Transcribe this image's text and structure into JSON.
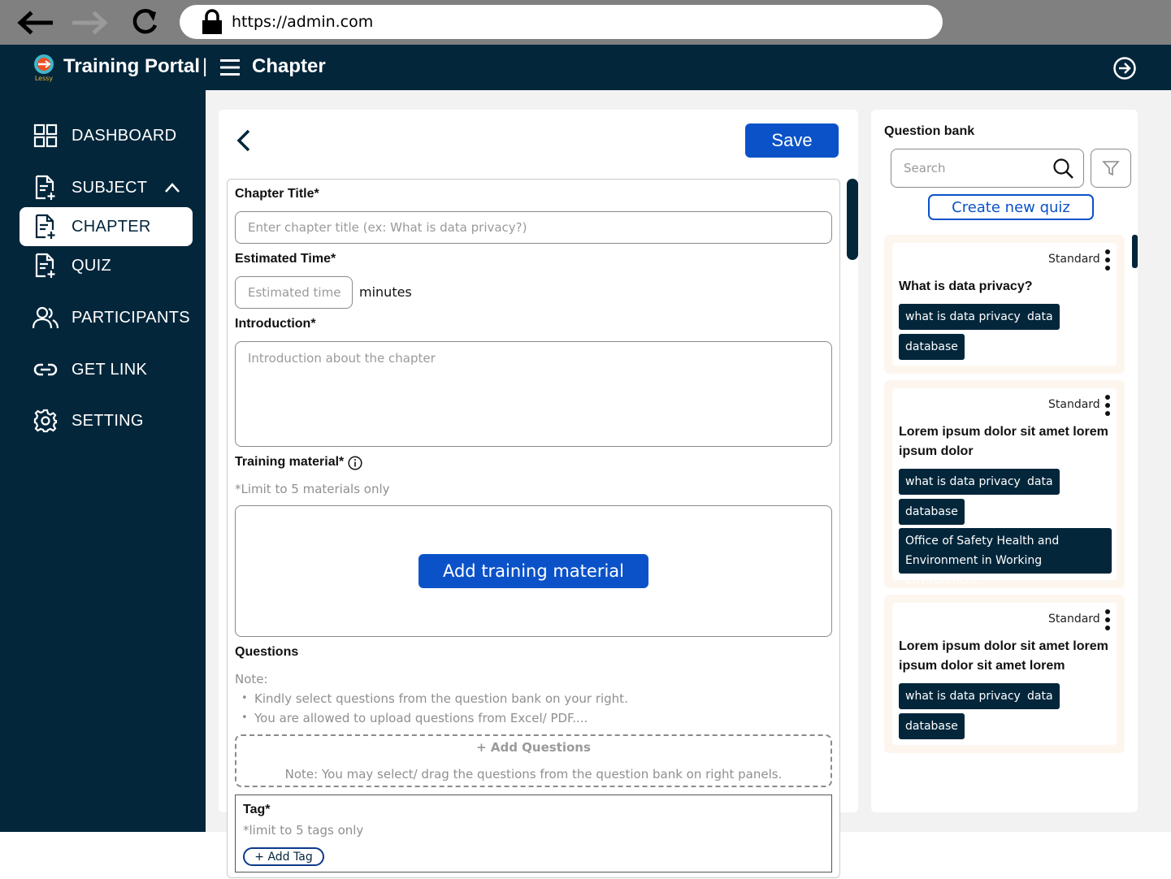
{
  "browser": {
    "url": "https://admin.com"
  },
  "header": {
    "app_title": "Training Portal",
    "separator": "|",
    "page_title": "Chapter",
    "logo_text": "Lessy"
  },
  "sidebar": {
    "items": [
      {
        "label": "DASHBOARD",
        "icon": "grid-icon"
      },
      {
        "label": "SUBJECT",
        "icon": "document-add-icon"
      },
      {
        "label": "CHAPTER",
        "icon": "document-add-icon",
        "active": true
      },
      {
        "label": "QUIZ",
        "icon": "document-add-icon"
      },
      {
        "label": "PARTICIPANTS",
        "icon": "users-icon"
      },
      {
        "label": "GET LINK",
        "icon": "link-icon"
      },
      {
        "label": "SETTING",
        "icon": "gear-icon"
      }
    ]
  },
  "toolbar": {
    "save_label": "Save"
  },
  "form": {
    "chapter_title_label": "Chapter Title*",
    "chapter_title_placeholder": "Enter chapter title (ex: What is data privacy?)",
    "estimated_time_label": "Estimated Time*",
    "estimated_time_placeholder": "Estimated time",
    "estimated_time_unit": "minutes",
    "introduction_label": "Introduction*",
    "introduction_placeholder": "Introduction about the chapter",
    "training_material_label": "Training material*",
    "training_material_hint": "*Limit to 5 materials only",
    "add_material_label": "Add training material",
    "questions_label": "Questions",
    "note_label": "Note:",
    "notes": [
      "Kindly select questions from the question bank on your right.",
      "You are allowed to upload questions from Excel/ PDF...."
    ],
    "add_questions_label": "+ Add Questions",
    "drag_note": "Note: You may select/ drag the questions from the question bank on right panels.",
    "tag_label": "Tag*",
    "tag_hint": "*limit to 5 tags only",
    "add_tag_label": "+ Add Tag"
  },
  "question_bank": {
    "title": "Question bank",
    "search_placeholder": "Search",
    "create_quiz_label": "Create new quiz",
    "questions": [
      {
        "type": "Standard",
        "title": "What is data privacy?",
        "tags": [
          "what is data privacy",
          "data",
          "database"
        ]
      },
      {
        "type": "Standard",
        "title": "Lorem ipsum dolor sit amet lorem ipsum dolor",
        "tags": [
          "what is data privacy",
          "data",
          "database",
          "Office of Safety Health and Environment in Working Environment"
        ]
      },
      {
        "type": "Standard",
        "title": "Lorem ipsum dolor sit amet lorem ipsum dolor sit amet lorem",
        "tags": [
          "what is data privacy",
          "data",
          "database"
        ]
      }
    ]
  },
  "colors": {
    "navy": "#03263b",
    "primary": "#0b52c9",
    "content_bg": "#f2f2f2"
  }
}
